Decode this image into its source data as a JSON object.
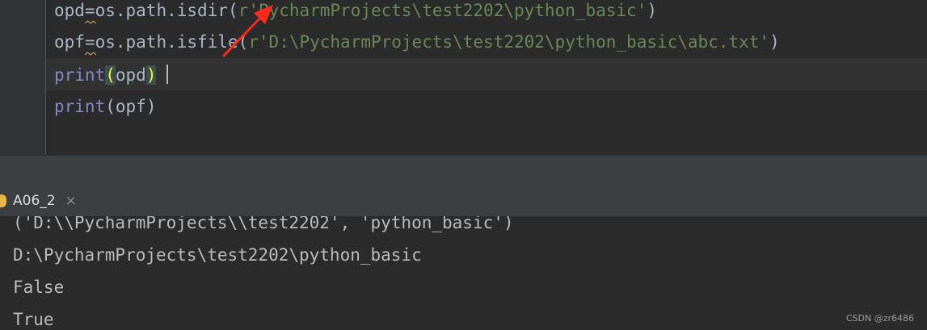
{
  "editor": {
    "lines": [
      {
        "var": "opd",
        "op": "=",
        "call": "os.path.isdir(",
        "prefix": "r",
        "string": "'PycharmProjects\\test2202\\python_basic'",
        "close": ")"
      },
      {
        "var": "opf",
        "op": "=",
        "call": "os.path.isfile(",
        "prefix": "r",
        "string": "'D:\\PycharmProjects\\test2202\\python_basic\\abc.txt'",
        "close": ")"
      },
      {
        "func": "print",
        "open": "(",
        "arg": "opd",
        "close": ")"
      },
      {
        "func": "print",
        "open": "(",
        "arg": "opf",
        "close": ")"
      }
    ]
  },
  "run_panel": {
    "tab_label": "A06_2",
    "close_glyph": "×"
  },
  "console": {
    "lines": [
      "('D:\\\\PycharmProjects\\\\test2202', 'python_basic')",
      "D:\\PycharmProjects\\test2202\\python_basic",
      "False",
      "True"
    ]
  },
  "watermark": "CSDN @zr6486",
  "colors": {
    "editor_bg": "#2b2b2b",
    "string": "#6a8759",
    "builtin": "#8888c6",
    "paren_highlight": "#ffef28",
    "annotation_arrow": "#ff2a1a"
  }
}
